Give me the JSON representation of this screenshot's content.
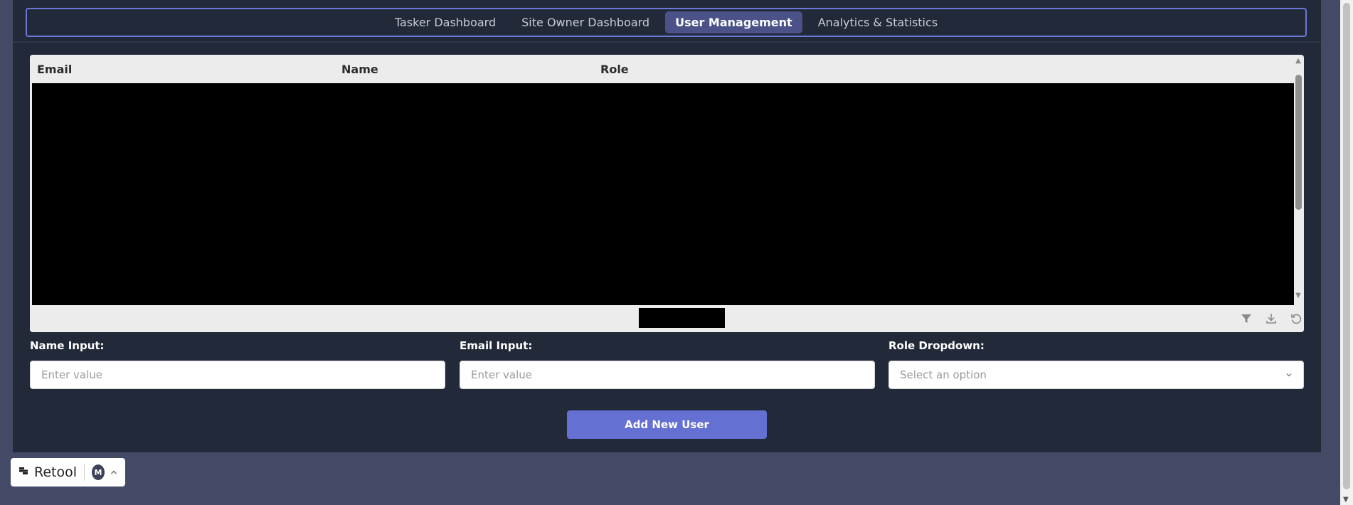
{
  "tabs": [
    {
      "label": "Tasker Dashboard",
      "active": false
    },
    {
      "label": "Site Owner Dashboard",
      "active": false
    },
    {
      "label": "User Management",
      "active": true
    },
    {
      "label": "Analytics & Statistics",
      "active": false
    }
  ],
  "table": {
    "columns": [
      "Email",
      "Name",
      "Role"
    ],
    "footer_icons": [
      "filter-icon",
      "download-icon",
      "refresh-icon"
    ]
  },
  "form": {
    "name_label": "Name Input:",
    "name_placeholder": "Enter value",
    "email_label": "Email Input:",
    "email_placeholder": "Enter value",
    "role_label": "Role Dropdown:",
    "role_placeholder": "Select an option",
    "submit_label": "Add New User"
  },
  "badge": {
    "brand": "Retool",
    "avatar_initial": "M"
  },
  "colors": {
    "page_bg": "#434a66",
    "panel_bg": "#222938",
    "accent": "#6470d2",
    "active_tab": "#4a5288"
  }
}
